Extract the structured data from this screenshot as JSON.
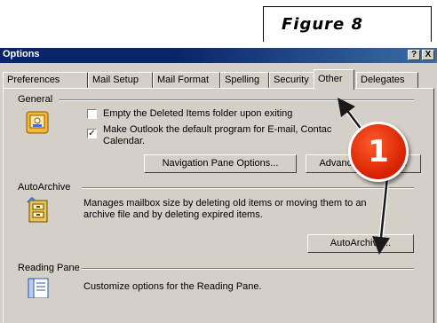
{
  "figure": {
    "caption": "Figure 8"
  },
  "window": {
    "title": "Options",
    "help_label": "?",
    "close_label": "X"
  },
  "tabs": [
    {
      "label": "Preferences"
    },
    {
      "label": "Mail Setup"
    },
    {
      "label": "Mail Format"
    },
    {
      "label": "Spelling"
    },
    {
      "label": "Security"
    },
    {
      "label": "Other",
      "active": true
    },
    {
      "label": "Delegates"
    }
  ],
  "general": {
    "heading": "General",
    "empty_deleted_label": "Empty the Deleted Items folder upon exiting",
    "empty_deleted_checked": false,
    "default_program_label_line1": "Make Outlook the default program for E-mail, Contac",
    "default_program_label_line2": "Calendar.",
    "default_program_checked": true,
    "check_mark": "✓",
    "nav_pane_button": "Navigation Pane Options...",
    "advanced_button": "Advanced Options..."
  },
  "autoarchive": {
    "heading": "AutoArchive",
    "description_line1": "Manages mailbox size by deleting old items or moving them to an",
    "description_line2": "archive file and by deleting expired items.",
    "button": "AutoArchive..."
  },
  "reading_pane": {
    "heading": "Reading Pane",
    "description": "Customize options for the Reading Pane."
  },
  "callout": {
    "number": "1",
    "color": "#e02a00"
  }
}
